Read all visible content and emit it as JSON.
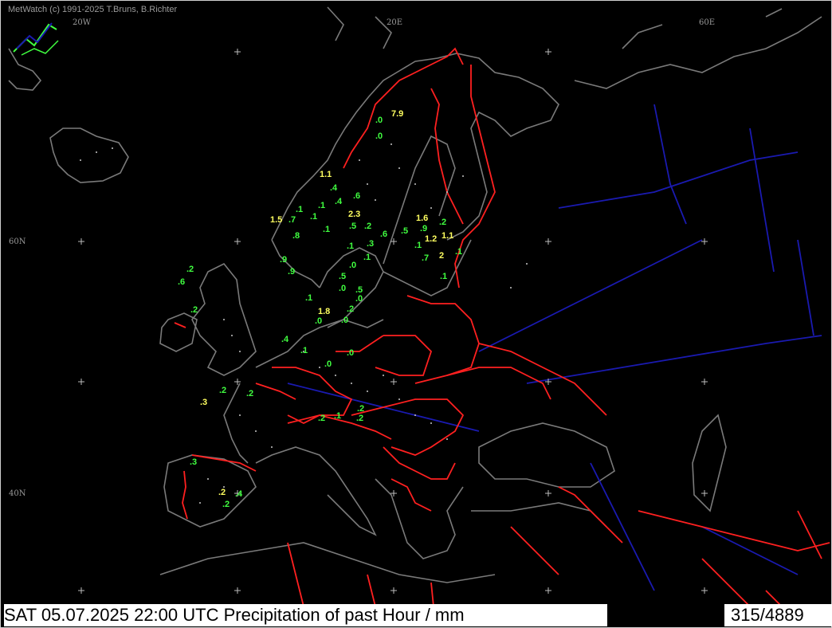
{
  "app": {
    "copyright": "MetWatch  (c) 1991-2025 T.Bruns, B.Richter"
  },
  "grid_labels": {
    "lon_20w": "20W",
    "lon_20e": "20E",
    "lon_60e": "60E",
    "lat_60n": "60N",
    "lat_40n": "40N"
  },
  "colors": {
    "background": "#000000",
    "coast": "#7a7a7a",
    "border": "#ff2020",
    "river": "#1a1ab0",
    "value_low": "#40ff40",
    "value_high": "#ffff60",
    "station_dot": "#c8c8c8"
  },
  "icons": {
    "logo": "metwatch-logo-icon"
  },
  "footer": {
    "datetime_title": "SAT 05.07.2025 22:00 UTC    Precipitation of past  Hour  / mm",
    "station_count": "315/4889"
  },
  "values": [
    {
      "t": "7.9",
      "c": "high"
    },
    {
      "t": ".0",
      "c": "low"
    },
    {
      "t": ".0",
      "c": "low"
    },
    {
      "t": "1.1",
      "c": "high"
    },
    {
      "t": ".4",
      "c": "low"
    },
    {
      "t": ".4",
      "c": "low"
    },
    {
      "t": ".6",
      "c": "low"
    },
    {
      "t": ".1",
      "c": "low"
    },
    {
      "t": ".1",
      "c": "low"
    },
    {
      "t": "1.5",
      "c": "high"
    },
    {
      "t": ".7",
      "c": "low"
    },
    {
      "t": ".1",
      "c": "low"
    },
    {
      "t": "2.3",
      "c": "high"
    },
    {
      "t": ".5",
      "c": "low"
    },
    {
      "t": ".2",
      "c": "low"
    },
    {
      "t": ".6",
      "c": "low"
    },
    {
      "t": ".5",
      "c": "low"
    },
    {
      "t": ".8",
      "c": "low"
    },
    {
      "t": ".1",
      "c": "low"
    },
    {
      "t": "1.6",
      "c": "high"
    },
    {
      "t": ".2",
      "c": "low"
    },
    {
      "t": ".9",
      "c": "low"
    },
    {
      "t": "1.2",
      "c": "high"
    },
    {
      "t": "1.1",
      "c": "high"
    },
    {
      "t": ".1",
      "c": "low"
    },
    {
      "t": ".1",
      "c": "low"
    },
    {
      "t": ".3",
      "c": "low"
    },
    {
      "t": ".9",
      "c": "low"
    },
    {
      "t": ".1",
      "c": "low"
    },
    {
      "t": "2",
      "c": "high"
    },
    {
      "t": ".1",
      "c": "low"
    },
    {
      "t": ".7",
      "c": "low"
    },
    {
      "t": ".9",
      "c": "low"
    },
    {
      "t": ".0",
      "c": "low"
    },
    {
      "t": ".5",
      "c": "low"
    },
    {
      "t": ".1",
      "c": "low"
    },
    {
      "t": ".0",
      "c": "low"
    },
    {
      "t": ".5",
      "c": "low"
    },
    {
      "t": ".0",
      "c": "low"
    },
    {
      "t": ".2",
      "c": "low"
    },
    {
      "t": ".6",
      "c": "low"
    },
    {
      "t": ".2",
      "c": "low"
    },
    {
      "t": ".1",
      "c": "low"
    },
    {
      "t": "1.8",
      "c": "high"
    },
    {
      "t": ".2",
      "c": "low"
    },
    {
      "t": ".0",
      "c": "low"
    },
    {
      "t": ".0",
      "c": "low"
    },
    {
      "t": ".4",
      "c": "low"
    },
    {
      "t": ".1",
      "c": "low"
    },
    {
      "t": ".0",
      "c": "low"
    },
    {
      "t": ".0",
      "c": "low"
    },
    {
      "t": ".2",
      "c": "low"
    },
    {
      "t": ".2",
      "c": "low"
    },
    {
      "t": ".3",
      "c": "high"
    },
    {
      "t": ".2",
      "c": "low"
    },
    {
      "t": ".2",
      "c": "low"
    },
    {
      "t": ".1",
      "c": "low"
    },
    {
      "t": ".2",
      "c": "low"
    },
    {
      "t": ".3",
      "c": "low"
    },
    {
      "t": ".2",
      "c": "high"
    },
    {
      "t": ".4",
      "c": "low"
    },
    {
      "t": ".2",
      "c": "low"
    }
  ]
}
